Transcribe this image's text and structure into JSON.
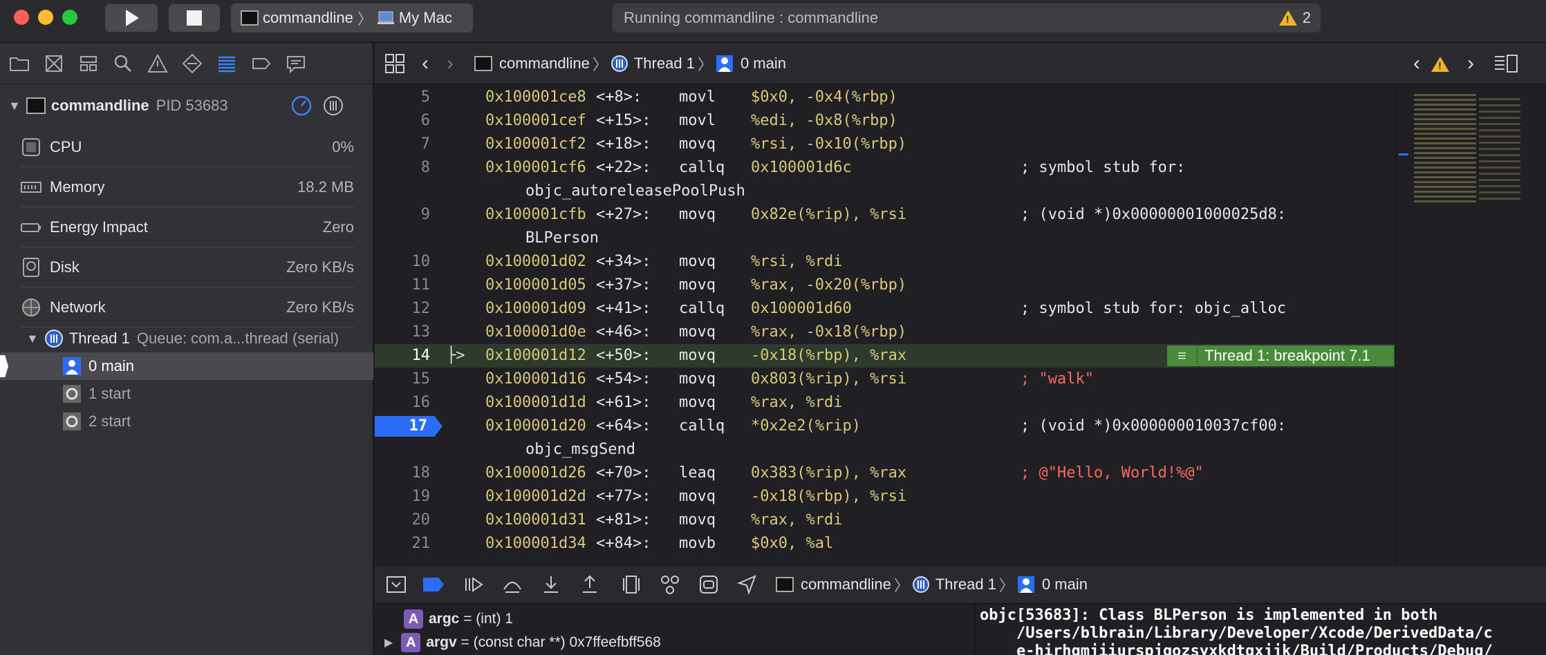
{
  "toolbar": {
    "scheme_name": "commandline",
    "destination": "My Mac",
    "status_text": "Running commandline : commandline",
    "warning_count": "2"
  },
  "process": {
    "name": "commandline",
    "pid": "PID 53683"
  },
  "gauges": [
    {
      "label": "CPU",
      "value": "0%"
    },
    {
      "label": "Memory",
      "value": "18.2 MB"
    },
    {
      "label": "Energy Impact",
      "value": "Zero"
    },
    {
      "label": "Disk",
      "value": "Zero KB/s"
    },
    {
      "label": "Network",
      "value": "Zero KB/s"
    }
  ],
  "thread": {
    "name": "Thread 1",
    "queue": "Queue: com.a...thread (serial)"
  },
  "frames": [
    "0 main",
    "1 start",
    "2 start"
  ],
  "jumpbar": {
    "target": "commandline",
    "thread": "Thread 1",
    "frame": "0 main"
  },
  "code_lines": [
    {
      "n": "5",
      "addr": "0x100001ce8",
      "off": "<+8>:",
      "op": "movl",
      "args": "$0x0, -0x4(%rbp)",
      "comment": ""
    },
    {
      "n": "6",
      "addr": "0x100001cef",
      "off": "<+15>:",
      "op": "movl",
      "args": "%edi, -0x8(%rbp)",
      "comment": ""
    },
    {
      "n": "7",
      "addr": "0x100001cf2",
      "off": "<+18>:",
      "op": "movq",
      "args": "%rsi, -0x10(%rbp)",
      "comment": ""
    },
    {
      "n": "8",
      "addr": "0x100001cf6",
      "off": "<+22>:",
      "op": "callq",
      "args": "0x100001d6c",
      "comment": "; symbol stub for:",
      "cont": "objc_autoreleasePoolPush"
    },
    {
      "n": "9",
      "addr": "0x100001cfb",
      "off": "<+27>:",
      "op": "movq",
      "args": "0x82e(%rip), %rsi",
      "comment": "; (void *)0x00000001000025d8:",
      "cont": "BLPerson"
    },
    {
      "n": "10",
      "addr": "0x100001d02",
      "off": "<+34>:",
      "op": "movq",
      "args": "%rsi, %rdi",
      "comment": ""
    },
    {
      "n": "11",
      "addr": "0x100001d05",
      "off": "<+37>:",
      "op": "movq",
      "args": "%rax, -0x20(%rbp)",
      "comment": ""
    },
    {
      "n": "12",
      "addr": "0x100001d09",
      "off": "<+41>:",
      "op": "callq",
      "args": "0x100001d60",
      "comment": "; symbol stub for: objc_alloc"
    },
    {
      "n": "13",
      "addr": "0x100001d0e",
      "off": "<+46>:",
      "op": "movq",
      "args": "%rax, -0x18(%rbp)",
      "comment": ""
    },
    {
      "n": "14",
      "addr": "0x100001d12",
      "off": "<+50>:",
      "op": "movq",
      "args": "-0x18(%rbp), %rax",
      "comment": ""
    },
    {
      "n": "15",
      "addr": "0x100001d16",
      "off": "<+54>:",
      "op": "movq",
      "args": "0x803(%rip), %rsi",
      "comment": "; \"walk\""
    },
    {
      "n": "16",
      "addr": "0x100001d1d",
      "off": "<+61>:",
      "op": "movq",
      "args": "%rax, %rdi",
      "comment": ""
    },
    {
      "n": "17",
      "addr": "0x100001d20",
      "off": "<+64>:",
      "op": "callq",
      "args": "*0x2e2(%rip)",
      "comment": "; (void *)0x000000010037cf00:",
      "cont": "objc_msgSend"
    },
    {
      "n": "18",
      "addr": "0x100001d26",
      "off": "<+70>:",
      "op": "leaq",
      "args": "0x383(%rip), %rax",
      "comment": "; @\"Hello, World!%@\""
    },
    {
      "n": "19",
      "addr": "0x100001d2d",
      "off": "<+77>:",
      "op": "movq",
      "args": "-0x18(%rbp), %rsi",
      "comment": ""
    },
    {
      "n": "20",
      "addr": "0x100001d31",
      "off": "<+81>:",
      "op": "movq",
      "args": "%rax, %rdi",
      "comment": ""
    },
    {
      "n": "21",
      "addr": "0x100001d34",
      "off": "<+84>:",
      "op": "movb",
      "args": "$0x0, %al",
      "comment": ""
    }
  ],
  "breakpoint_label": "Thread 1: breakpoint 7.1",
  "variables": [
    {
      "name": "argc",
      "detail": " = (int) 1"
    },
    {
      "name": "argv",
      "detail": " = (const char **) 0x7ffeefbff568"
    }
  ],
  "console_lines": [
    "objc[53683]: Class BLPerson is implemented in both",
    "    /Users/blbrain/Library/Developer/Xcode/DerivedData/c",
    "    e-hirhgmjiiurspjgozsyxkdtqxjjk/Build/Products/Debug/"
  ],
  "colors": {
    "accent": "#2b6ef5",
    "breakpoint_line": "#2f3d2f",
    "breakpoint_badge": "#4a8a3b",
    "string": "#fc6a5d",
    "address": "#d9c97c"
  }
}
